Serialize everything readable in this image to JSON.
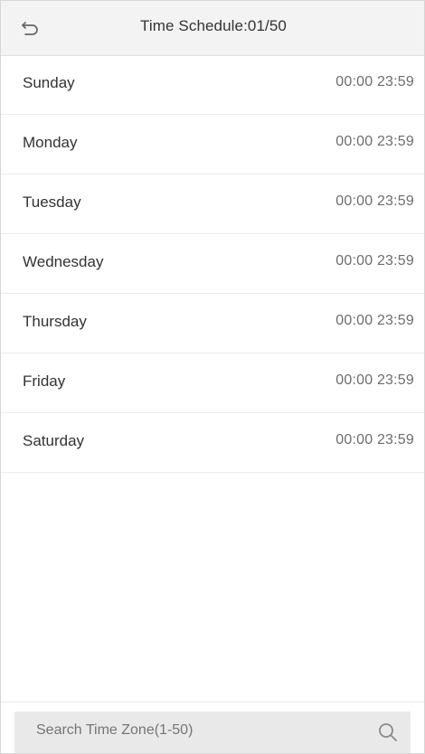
{
  "header": {
    "title": "Time Schedule:01/50",
    "back_icon": "back-icon"
  },
  "schedule": [
    {
      "day": "Sunday",
      "start": "00:00",
      "end": "23:59"
    },
    {
      "day": "Monday",
      "start": "00:00",
      "end": "23:59"
    },
    {
      "day": "Tuesday",
      "start": "00:00",
      "end": "23:59"
    },
    {
      "day": "Wednesday",
      "start": "00:00",
      "end": "23:59"
    },
    {
      "day": "Thursday",
      "start": "00:00",
      "end": "23:59"
    },
    {
      "day": "Friday",
      "start": "00:00",
      "end": "23:59"
    },
    {
      "day": "Saturday",
      "start": "00:00",
      "end": "23:59"
    }
  ],
  "search": {
    "placeholder": "Search Time Zone(1-50)",
    "icon": "search-icon"
  },
  "colors": {
    "accent_green": "#2f9b3a",
    "header_bg": "#f3f3f3",
    "search_bg": "#e9e9e9"
  }
}
